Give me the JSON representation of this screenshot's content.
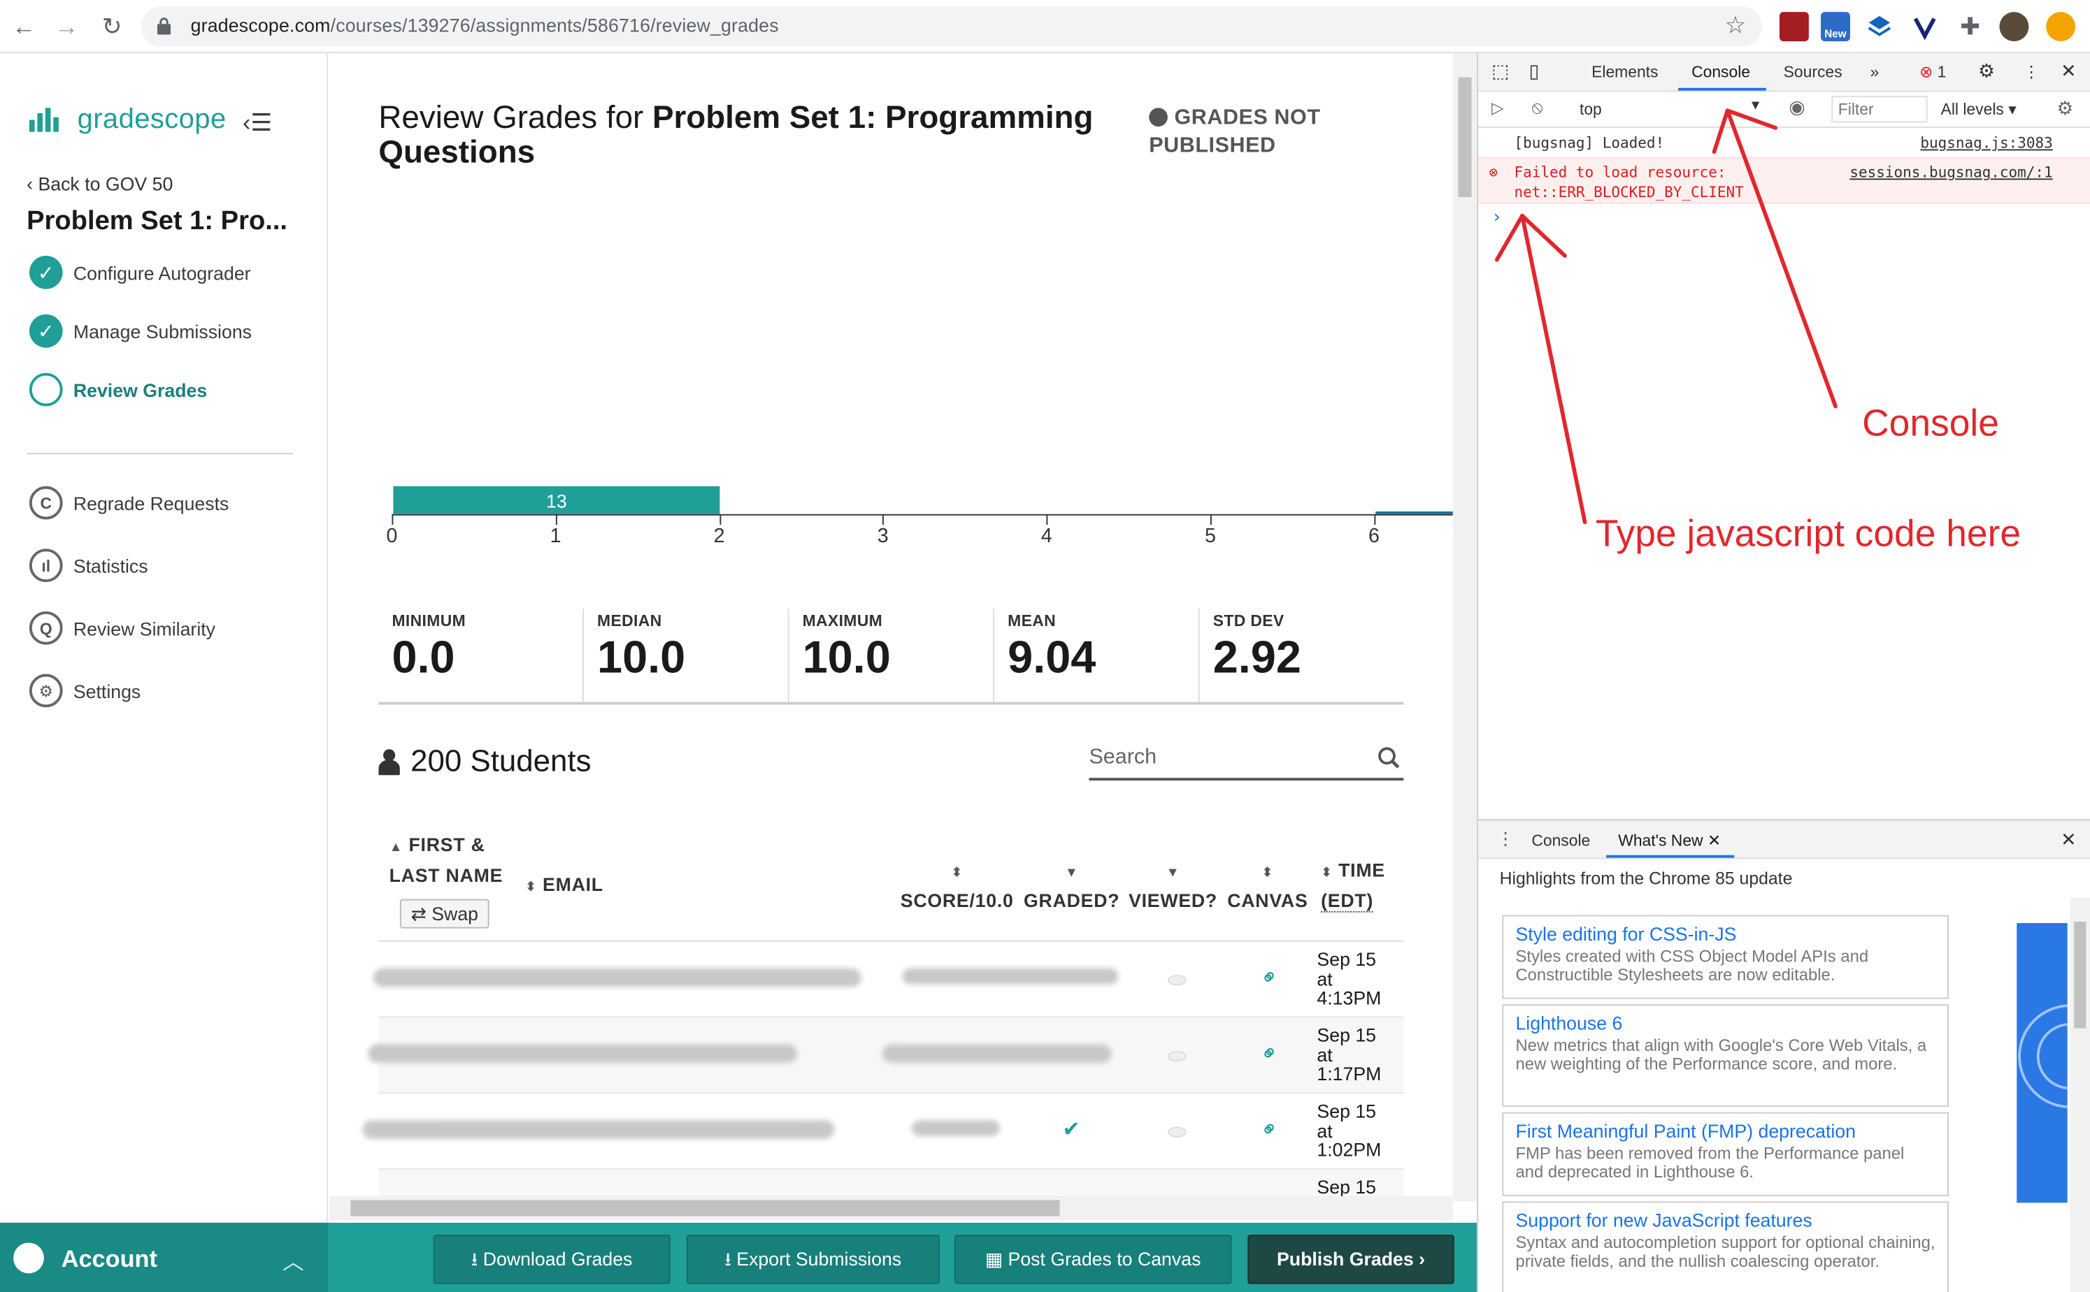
{
  "browser": {
    "url_host": "gradescope.com",
    "url_path": "/courses/139276/assignments/586716/review_grades",
    "ext_badge_new": "New"
  },
  "sidebar": {
    "brand": "gradescope",
    "back_link": "Back to GOV 50",
    "course_title": "Problem Set 1: Pro...",
    "steps": [
      {
        "label": "Configure Autograder",
        "state": "done"
      },
      {
        "label": "Manage Submissions",
        "state": "done"
      },
      {
        "label": "Review Grades",
        "state": "active"
      }
    ],
    "nav": [
      {
        "label": "Regrade Requests",
        "icon": "regrade-icon"
      },
      {
        "label": "Statistics",
        "icon": "statistics-icon"
      },
      {
        "label": "Review Similarity",
        "icon": "similarity-icon"
      },
      {
        "label": "Settings",
        "icon": "gear-icon"
      }
    ]
  },
  "main": {
    "title_prefix": "Review Grades for ",
    "title_bold": "Problem Set 1: Programming Questions",
    "status": "GRADES NOT PUBLISHED",
    "histogram": {
      "bar_value": "13",
      "ticks": [
        "0",
        "1",
        "2",
        "3",
        "4",
        "5",
        "6"
      ]
    },
    "stats": [
      {
        "label": "MINIMUM",
        "value": "0.0"
      },
      {
        "label": "MEDIAN",
        "value": "10.0"
      },
      {
        "label": "MAXIMUM",
        "value": "10.0"
      },
      {
        "label": "MEAN",
        "value": "9.04"
      },
      {
        "label": "STD DEV",
        "value": "2.92"
      }
    ],
    "students_count": "200 Students",
    "search_placeholder": "Search",
    "columns": {
      "name_line1": "FIRST &",
      "name_line2": "LAST NAME",
      "swap": "Swap",
      "email": "EMAIL",
      "score": "SCORE/10.0",
      "graded": "GRADED?",
      "viewed": "VIEWED?",
      "canvas": "CANVAS",
      "time_line1": "TIME",
      "time_line2": "(EDT)"
    },
    "rows": [
      {
        "time1": "Sep 15",
        "time2": "at",
        "time3": "4:13PM",
        "graded": ""
      },
      {
        "time1": "Sep 15",
        "time2": "at",
        "time3": "1:17PM",
        "graded": ""
      },
      {
        "time1": "Sep 15",
        "time2": "at",
        "time3": "1:02PM",
        "graded": "✔"
      },
      {
        "time1": "Sep 15",
        "time2": "",
        "time3": "",
        "graded": ""
      }
    ]
  },
  "footer": {
    "account": "Account",
    "buttons": [
      "Download Grades",
      "Export Submissions",
      "Post Grades to Canvas",
      "Publish Grades"
    ]
  },
  "devtools": {
    "tabs": [
      "Elements",
      "Console",
      "Sources"
    ],
    "error_count": "1",
    "context": "top",
    "filter_placeholder": "Filter",
    "levels": "All levels",
    "messages": [
      {
        "text": "[bugsnag] Loaded!",
        "source": "bugsnag.js:3083"
      },
      {
        "text1": "Failed to load resource:",
        "text2": "net::ERR_BLOCKED_BY_CLIENT",
        "source": "sessions.bugsnag.com/:1"
      }
    ],
    "prompt": "›",
    "annotation_console": "Console",
    "annotation_type": "Type javascript code here",
    "drawer_tabs": [
      "Console",
      "What's New"
    ],
    "drawer_subtitle": "Highlights from the Chrome 85 update",
    "cards": [
      {
        "title": "Style editing for CSS-in-JS",
        "desc": "Styles created with CSS Object Model APIs and Constructible Stylesheets are now editable."
      },
      {
        "title": "Lighthouse 6",
        "desc": "New metrics that align with Google's Core Web Vitals, a new weighting of the Performance score, and more."
      },
      {
        "title": "First Meaningful Paint (FMP) deprecation",
        "desc": "FMP has been removed from the Performance panel and deprecated in Lighthouse 6."
      },
      {
        "title": "Support for new JavaScript features",
        "desc": "Syntax and autocompletion support for optional chaining, private fields, and the nullish coalescing operator."
      }
    ]
  },
  "colors": {
    "brand_teal": "#1f9f98",
    "annotation_red": "#e0282c",
    "devtools_blue": "#1a73e8"
  }
}
